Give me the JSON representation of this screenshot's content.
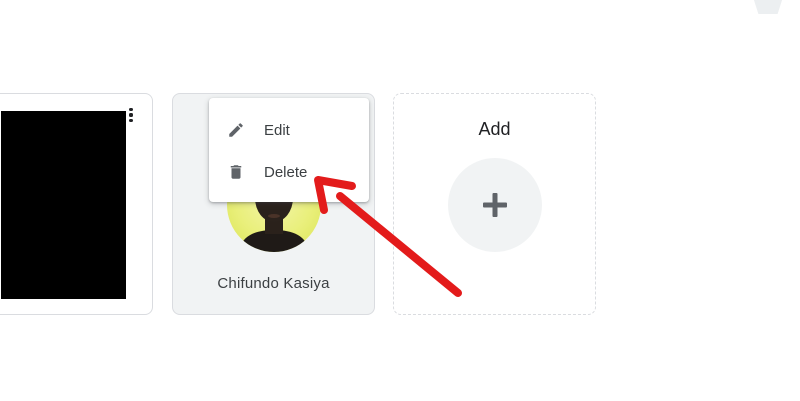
{
  "cards": [
    {
      "type": "video",
      "image": "black-thumbnail",
      "menu_icon": "more-vert-icon"
    },
    {
      "type": "person",
      "name": "Chifundo Kasiya",
      "image": "avatar-photo"
    }
  ],
  "add_card": {
    "title": "Add",
    "icon": "plus-icon"
  },
  "context_menu": {
    "items": [
      {
        "label": "Edit",
        "icon": "pencil-icon"
      },
      {
        "label": "Delete",
        "icon": "trash-icon"
      }
    ]
  },
  "annotation": {
    "type": "arrow",
    "color": "#e31b1b",
    "points_to": "Delete"
  },
  "colors": {
    "card_border": "#dadce0",
    "selected_card_bg": "#f1f3f4",
    "text": "#3c4043",
    "add_circle": "#f1f3f4",
    "avatar_bg": "#e9ef7a"
  }
}
